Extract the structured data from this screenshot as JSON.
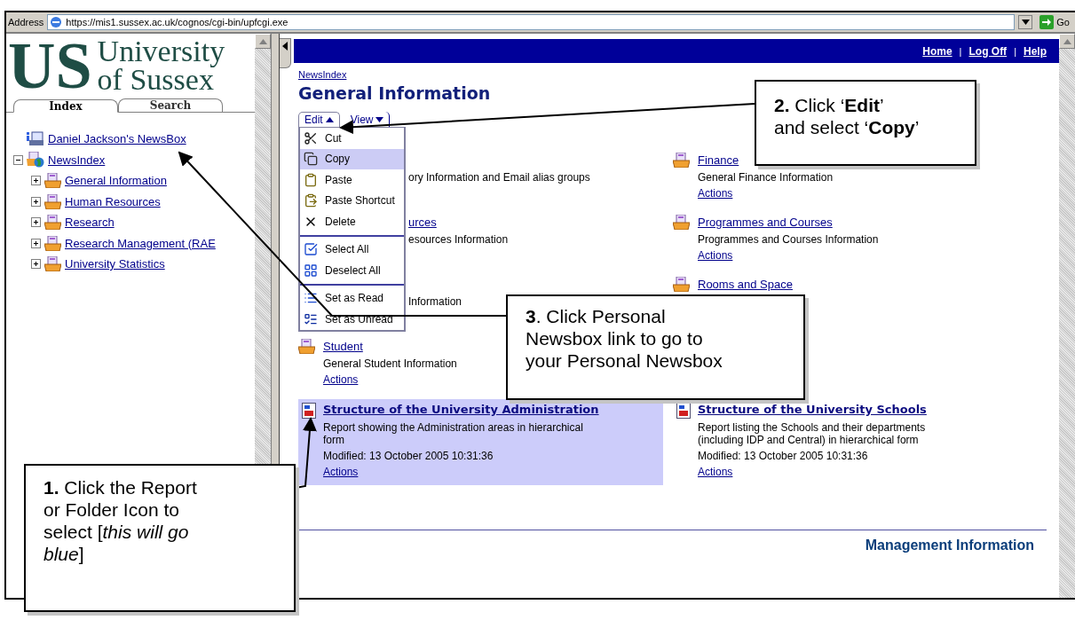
{
  "address_bar": {
    "label": "Address",
    "url": "https://mis1.sussex.ac.uk/cognos/cgi-bin/upfcgi.exe",
    "go_button": "Go"
  },
  "sidebar": {
    "logo": {
      "letters": "US",
      "line_1": "University",
      "line_2": "of Sussex"
    },
    "tabs": [
      {
        "label": "Index",
        "selected": true
      },
      {
        "label": "Search",
        "selected": false
      }
    ],
    "tree": [
      {
        "label": "Daniel Jackson's NewsBox",
        "kind": "newsbox"
      },
      {
        "label": "NewsIndex",
        "kind": "globe",
        "expanded": true,
        "children": [
          {
            "label": "General Information",
            "kind": "folder",
            "expanded": false
          },
          {
            "label": "Human Resources",
            "kind": "folder",
            "expanded": false
          },
          {
            "label": "Research",
            "kind": "folder",
            "expanded": false
          },
          {
            "label": "Research Management (RAE",
            "kind": "folder",
            "expanded": false
          },
          {
            "label": "University Statistics",
            "kind": "folder",
            "expanded": false
          }
        ]
      }
    ]
  },
  "header": {
    "links": [
      "Home",
      "Log Off",
      "Help"
    ],
    "separator": "|"
  },
  "breadcrumb": "NewsIndex",
  "title": "General Information",
  "toolbar": [
    {
      "label": "Edit",
      "selected": true
    },
    {
      "label": "View",
      "selected": false
    }
  ],
  "edit_menu": [
    [
      {
        "label": "Cut",
        "kind": "cut",
        "selected": false
      },
      {
        "label": "Copy",
        "kind": "copy",
        "selected": true
      },
      {
        "label": "Paste",
        "kind": "paste",
        "selected": false
      },
      {
        "label": "Paste Shortcut",
        "kind": "shortcut",
        "selected": false
      },
      {
        "label": "Delete",
        "kind": "delete",
        "selected": false
      }
    ],
    [
      {
        "label": "Select All",
        "kind": "select_all",
        "selected": false
      },
      {
        "label": "Deselect All",
        "kind": "deselect_all",
        "selected": false
      }
    ],
    [
      {
        "label": "Set as Read",
        "kind": "read",
        "selected": false
      },
      {
        "label": "Set as Unread",
        "kind": "unread",
        "selected": false
      }
    ]
  ],
  "left_column": [
    {
      "kind": "partial",
      "description": "ory Information and Email alias groups"
    },
    {
      "kind": "partial",
      "title": "urces",
      "description": "esources Information"
    },
    {
      "kind": "partial",
      "description": "Information"
    },
    {
      "kind": "full",
      "title": "Student",
      "description": "General Student Information",
      "actions": "Actions"
    }
  ],
  "right_column": [
    {
      "kind": "full",
      "title": "Finance",
      "description": "General Finance Information",
      "actions": "Actions"
    },
    {
      "kind": "full",
      "title": "Programmes and Courses",
      "description": "Programmes and Courses Information",
      "actions": "Actions"
    },
    {
      "kind": "full",
      "title": "Rooms and Space"
    }
  ],
  "reports": [
    {
      "title": "Structure of the University Administration",
      "description": "Report showing the Administration areas in hierarchical form",
      "modified": "Modified: 13 October 2005 10:31:36",
      "actions": "Actions",
      "selected": true
    },
    {
      "title": "Structure of the University Schools",
      "description": "Report listing the Schools and their departments (including IDP and Central) in hierarchical form",
      "modified": "Modified: 13 October 2005 10:31:36",
      "actions": "Actions",
      "selected": false
    }
  ],
  "footer": "Management Information",
  "callouts": [
    {
      "lines": [
        "**1.** Click the Report",
        "or Folder Icon to",
        "select [*this will go*",
        "*blue*]"
      ]
    },
    {
      "lines": [
        "**2.** Click ‘**Edit**’",
        "and select ‘**Copy**’"
      ]
    },
    {
      "lines": [
        "**3**. Click Personal",
        "Newsbox link to go to",
        "your Personal Newsbox"
      ]
    }
  ]
}
